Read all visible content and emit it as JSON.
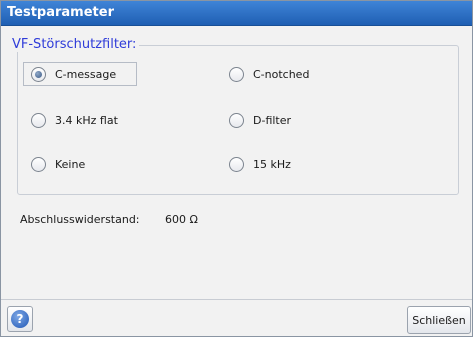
{
  "window": {
    "title": "Testparameter"
  },
  "filter_group": {
    "legend": "VF-Störschutzfilter:",
    "selected": "C-message",
    "options": [
      {
        "label": "C-message",
        "checked": true
      },
      {
        "label": "C-notched",
        "checked": false
      },
      {
        "label": "3.4 kHz flat",
        "checked": false
      },
      {
        "label": "D-filter",
        "checked": false
      },
      {
        "label": "Keine",
        "checked": false
      },
      {
        "label": "15 kHz",
        "checked": false
      }
    ]
  },
  "termination": {
    "label": "Abschlusswiderstand:",
    "value": "600 Ω"
  },
  "footer": {
    "help_icon": "question-mark",
    "close_label": "Schließen"
  },
  "colors": {
    "title_bar": "#2b6fc6",
    "legend_text": "#2f3cd9"
  }
}
